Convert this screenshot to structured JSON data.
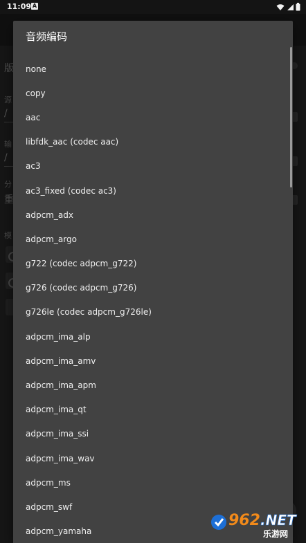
{
  "status_bar": {
    "time": "11:09",
    "notification_icon": "a-icon",
    "icons": [
      "wifi-icon",
      "signal-icon",
      "battery-icon"
    ]
  },
  "background": {
    "rows": [
      {
        "label": "版",
        "value": ""
      },
      {
        "label": "源",
        "value": "/"
      },
      {
        "label": "输",
        "value": "/"
      },
      {
        "label": "分",
        "value": "重"
      },
      {
        "label": "模",
        "value": ""
      }
    ]
  },
  "dialog": {
    "title": "音频编码",
    "options": [
      "none",
      "copy",
      "aac",
      "libfdk_aac (codec aac)",
      "ac3",
      "ac3_fixed (codec ac3)",
      "adpcm_adx",
      "adpcm_argo",
      "g722 (codec adpcm_g722)",
      "g726 (codec adpcm_g726)",
      "g726le (codec adpcm_g726le)",
      "adpcm_ima_alp",
      "adpcm_ima_amv",
      "adpcm_ima_apm",
      "adpcm_ima_qt",
      "adpcm_ima_ssi",
      "adpcm_ima_wav",
      "adpcm_ms",
      "adpcm_swf",
      "adpcm_yamaha"
    ]
  },
  "watermark": {
    "brand": "962.NET",
    "subtitle": "乐游网"
  },
  "colors": {
    "dialog_bg": "#424242",
    "scrim": "#000000",
    "text_primary": "#f0f0f0",
    "watermark_orange": "#f28a1a",
    "watermark_blue": "#1d6fd6"
  }
}
